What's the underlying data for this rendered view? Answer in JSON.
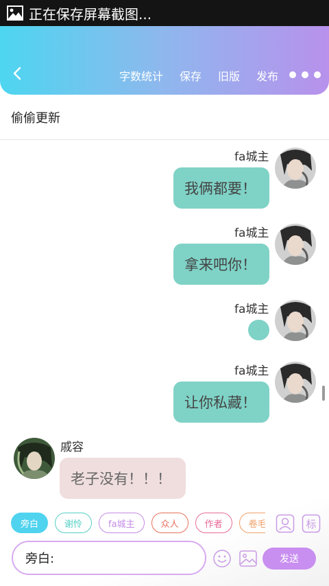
{
  "status_bar": {
    "text": "正在保存屏幕截图..."
  },
  "toolbar": {
    "menu": [
      "字数统计",
      "保存",
      "旧版",
      "发布"
    ]
  },
  "doc_title": "偷偷更新",
  "messages": [
    {
      "side": "right",
      "name": "fa城主",
      "text": "我俩都要！"
    },
    {
      "side": "right",
      "name": "fa城主",
      "text": "拿来吧你！"
    },
    {
      "side": "right",
      "name": "fa城主",
      "text": "·"
    },
    {
      "side": "right",
      "name": "fa城主",
      "text": "让你私藏！"
    },
    {
      "side": "left",
      "name": "戚容",
      "text": "老子没有！！！"
    }
  ],
  "roles": [
    {
      "label": "旁白",
      "color": "#4fd3ef",
      "active": true
    },
    {
      "label": "谢怜",
      "color": "#55cfc4",
      "active": false
    },
    {
      "label": "fa城主",
      "color": "#c48ae6",
      "active": false
    },
    {
      "label": "众人",
      "color": "#e8705c",
      "active": false
    },
    {
      "label": "作者",
      "color": "#e86a98",
      "active": false
    },
    {
      "label": "卷毛",
      "color": "#f0a06a",
      "active": false
    }
  ],
  "input": {
    "value": "旁白:"
  },
  "send_label": "发送",
  "colors": {
    "accent": "#c88ef0",
    "bubble_right": "#7fd2c6",
    "bubble_left": "#f0dede"
  }
}
